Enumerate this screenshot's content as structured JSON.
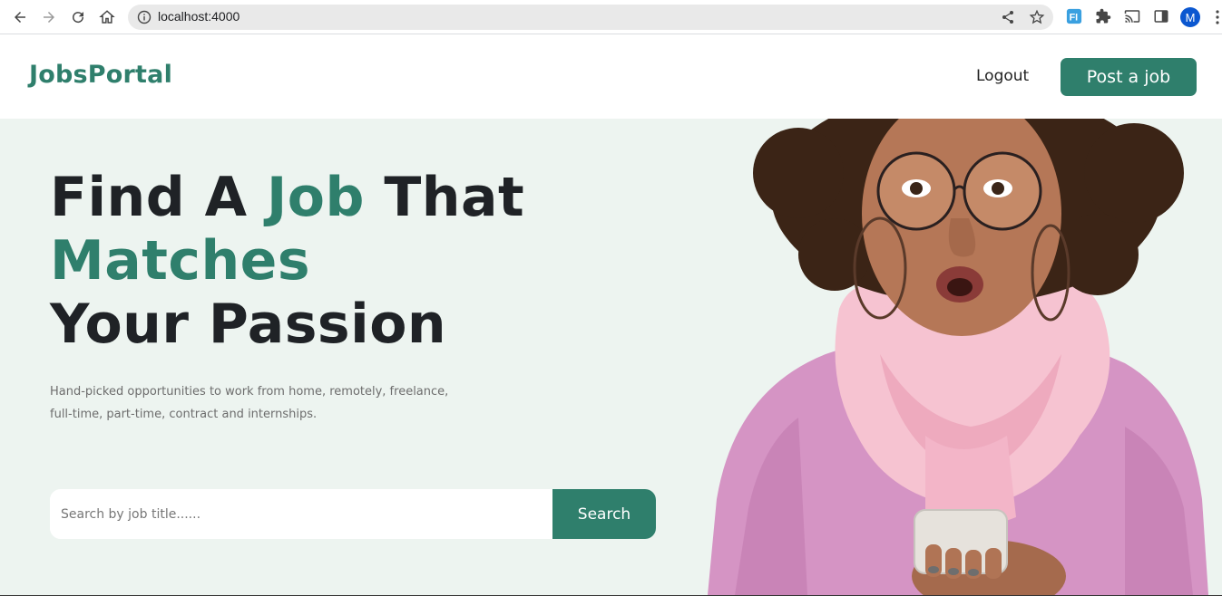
{
  "browser": {
    "url": "localhost:4000",
    "profile_initial": "M"
  },
  "header": {
    "logo": "JobsPortal",
    "logout_label": "Logout",
    "post_job_label": "Post a job"
  },
  "hero": {
    "headline": {
      "line1_part1": "Find A ",
      "line1_accent": "Job",
      "line1_part2": " That",
      "line2_accent": "Matches",
      "line3": "Your Passion"
    },
    "subtext_line1": "Hand-picked opportunities to work from home, remotely, freelance,",
    "subtext_line2": "full-time, part-time, contract and internships.",
    "search": {
      "placeholder": "Search by job title......",
      "button_label": "Search"
    },
    "image": "woman-with-phone-photo"
  },
  "colors": {
    "brand": "#2f7f6c",
    "hero_bg": "#edf4f0",
    "headline": "#1f2226"
  }
}
